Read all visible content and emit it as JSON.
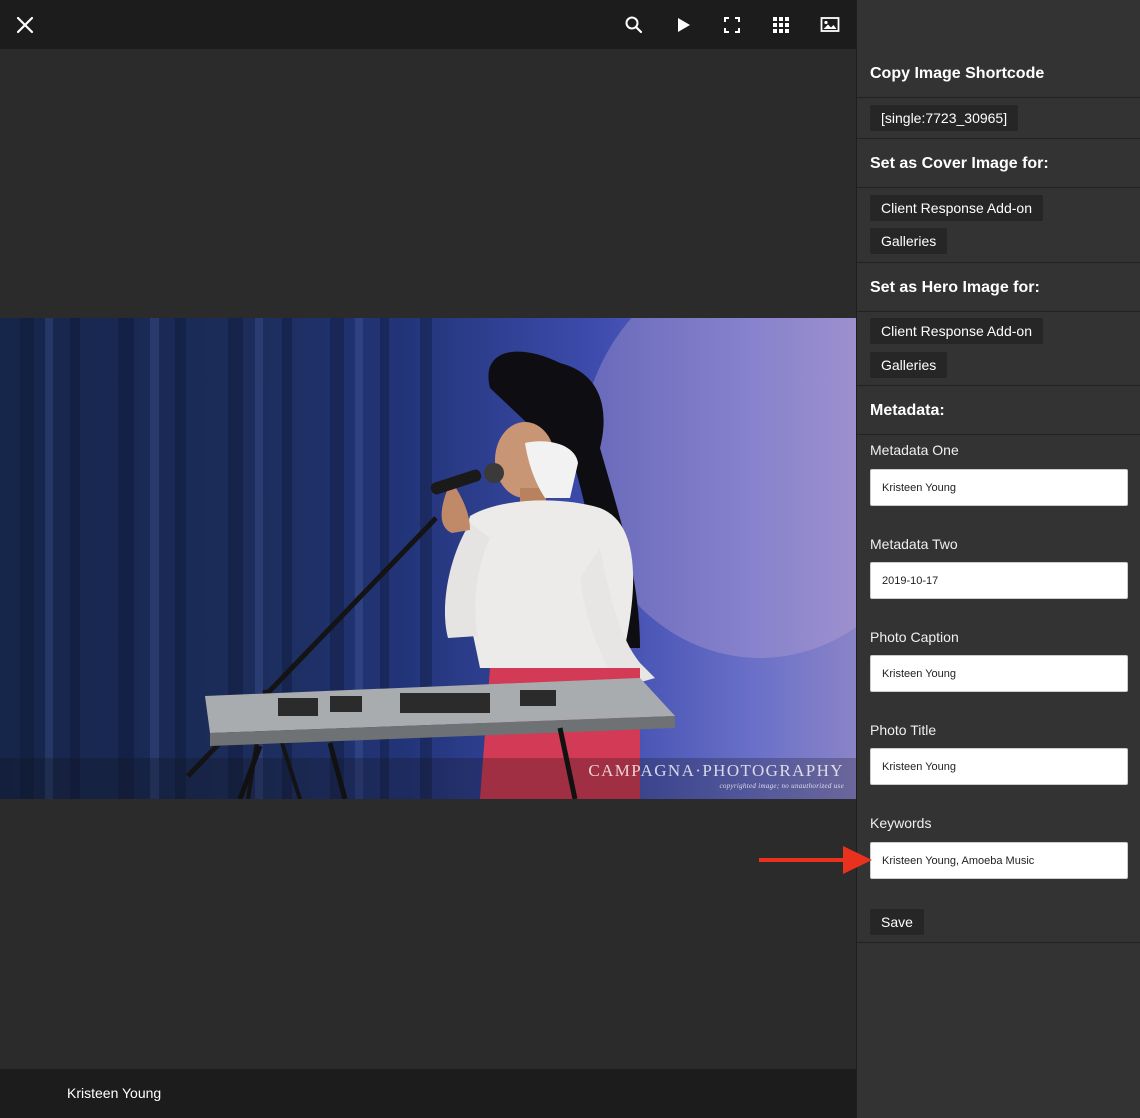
{
  "toolbar": {
    "close_icon": "close-icon",
    "search_icon": "search-icon",
    "play_icon": "play-icon",
    "fullscreen_icon": "fullscreen-icon",
    "grid_icon": "grid-icon",
    "image_icon": "image-icon"
  },
  "photo": {
    "watermark": "CAMPAGNA·PHOTOGRAPHY",
    "watermark_sub": "copyrighted image; no unauthorized use"
  },
  "footer": {
    "caption": "Kristeen Young"
  },
  "sidebar": {
    "shortcode": {
      "title": "Copy Image Shortcode",
      "value": "[single:7723_30965]"
    },
    "cover": {
      "title": "Set as Cover Image for:",
      "options": [
        "Client Response Add-on",
        "Galleries"
      ]
    },
    "hero": {
      "title": "Set as Hero Image for:",
      "options": [
        "Client Response Add-on",
        "Galleries"
      ]
    },
    "metadata": {
      "title": "Metadata:",
      "fields": [
        {
          "label": "Metadata One",
          "value": "Kristeen Young"
        },
        {
          "label": "Metadata Two",
          "value": "2019-10-17"
        },
        {
          "label": "Photo Caption",
          "value": "Kristeen Young"
        },
        {
          "label": "Photo Title",
          "value": "Kristeen Young"
        },
        {
          "label": "Keywords",
          "value": "Kristeen Young, Amoeba Music"
        }
      ],
      "save_label": "Save"
    }
  },
  "colors": {
    "annotation_arrow": "#e8321e",
    "panel_bg": "#333333",
    "viewer_bg": "#2b2b2b",
    "bar_bg": "#1c1c1c"
  }
}
